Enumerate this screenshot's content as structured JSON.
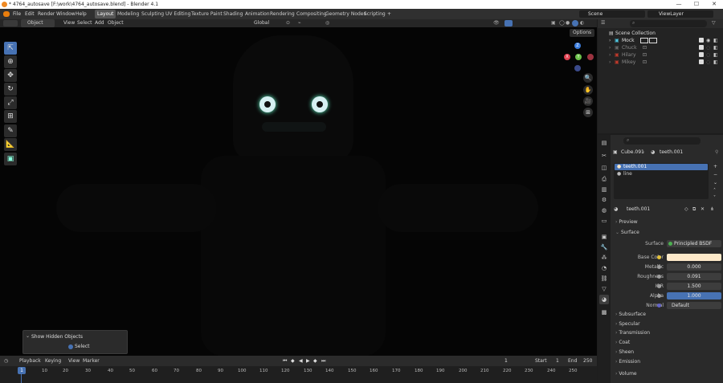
{
  "window": {
    "title": "* 4764_autosave [F:\\work\\4764_autosave.blend] - Blender 4.1",
    "minimize": "—",
    "maximize": "☐",
    "close": "✕"
  },
  "menubar": {
    "items": [
      "File",
      "Edit",
      "Render",
      "Window",
      "Help"
    ]
  },
  "workspaces": {
    "tabs": [
      "Layout",
      "Modeling",
      "Sculpting",
      "UV Editing",
      "Texture Paint",
      "Shading",
      "Animation",
      "Rendering",
      "Compositing",
      "Geometry Nodes",
      "Scripting"
    ],
    "active": "Layout",
    "add": "+"
  },
  "scene": {
    "name": "Scene",
    "view_layer": "ViewLayer"
  },
  "viewport_header": {
    "mode": "Object Mode",
    "menus": [
      "View",
      "Select",
      "Add",
      "Object"
    ],
    "orientation": "Global",
    "options": "Options"
  },
  "gizmo": {
    "x": "X",
    "y": "Y",
    "z": "Z"
  },
  "last_operator": {
    "title": "Show Hidden Objects",
    "select_label": "Select"
  },
  "timeline": {
    "menus": [
      "Playback",
      "Keying",
      "View",
      "Marker"
    ],
    "current_frame": "1",
    "start_label": "Start",
    "start": "1",
    "end_label": "End",
    "end": "250",
    "ticks": [
      "0",
      "10",
      "20",
      "30",
      "40",
      "50",
      "60",
      "70",
      "80",
      "90",
      "100",
      "110",
      "120",
      "130",
      "140",
      "150",
      "160",
      "170",
      "180",
      "190",
      "200",
      "210",
      "220",
      "230",
      "240",
      "250"
    ],
    "playhead": "1"
  },
  "outliner": {
    "search_placeholder": "",
    "root": "Scene Collection",
    "items": [
      {
        "name": "Mock",
        "color": "#e0e0e0"
      },
      {
        "name": "Chuck",
        "color": "#8a8a8a"
      },
      {
        "name": "Hilary",
        "color": "#8a8a8a"
      },
      {
        "name": "Mikey",
        "color": "#8a8a8a"
      }
    ]
  },
  "properties": {
    "breadcrumb_object": "Cube.091",
    "breadcrumb_material": "teeth.001",
    "slots": [
      "teeth.001",
      "line"
    ],
    "selected_slot": "teeth.001",
    "material_name": "teeth.001",
    "sections": {
      "preview": "Preview",
      "surface": "Surface",
      "subsurface": "Subsurface",
      "specular": "Specular",
      "transmission": "Transmission",
      "coat": "Coat",
      "sheen": "Sheen",
      "emission": "Emission",
      "volume": "Volume"
    },
    "fields": {
      "surface_label": "Surface",
      "surface_value": "Principled BSDF",
      "base_color_label": "Base Color",
      "base_color": "#fde9c9",
      "metallic_label": "Metallic",
      "metallic": "0.000",
      "roughness_label": "Roughness",
      "roughness": "0.091",
      "ior_label": "IOR",
      "ior": "1.500",
      "alpha_label": "Alpha",
      "alpha": "1.000",
      "normal_label": "Normal",
      "normal": "Default"
    }
  },
  "colors": {
    "accent": "#4772b3",
    "x_axis": "#e04050",
    "y_axis": "#6cc24a",
    "z_axis": "#3b7ddd"
  }
}
